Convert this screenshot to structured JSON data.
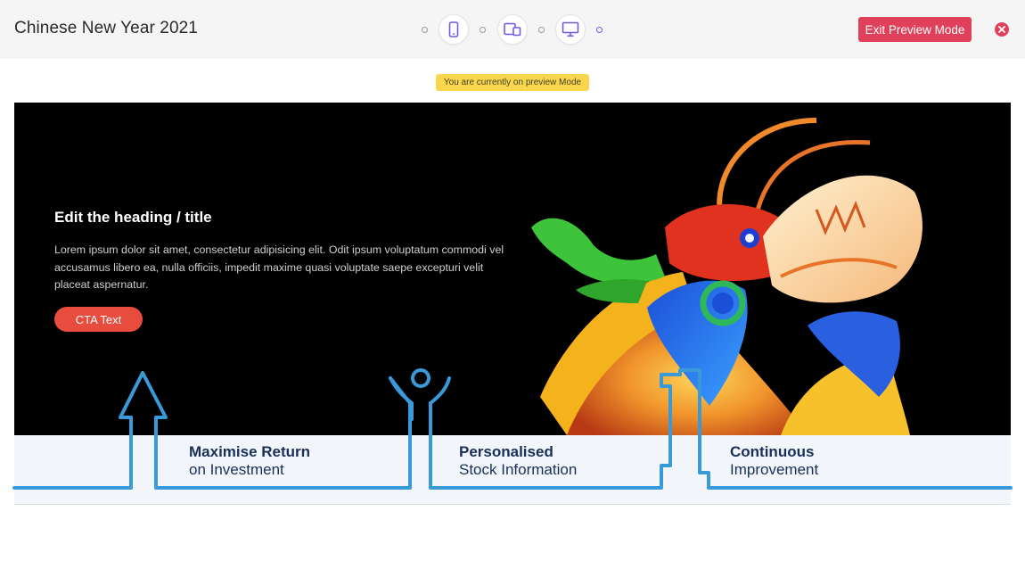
{
  "header": {
    "title": "Chinese New Year 2021",
    "exit_label": "Exit Preview Mode",
    "devices": [
      {
        "name": "mobile",
        "icon": "mobile-icon"
      },
      {
        "name": "tablet",
        "icon": "tablet-icon"
      },
      {
        "name": "desktop",
        "icon": "desktop-icon"
      }
    ],
    "accent_color": "#6b5ce7",
    "exit_color": "#e0405a"
  },
  "preview_notice": "You are currently on preview Mode",
  "hero": {
    "heading": "Edit the heading / title",
    "body": "Lorem ipsum dolor sit amet, consectetur adipisicing elit. Odit ipsum voluptatum commodi vel accusamus libero ea, nulla officiis, impedit maxime quasi voluptate saepe excepturi velit placeat aspernatur.",
    "cta": "CTA Text",
    "cta_color": "#e74c3c"
  },
  "features": [
    {
      "title": "Maximise Return",
      "subtitle": "on Investment"
    },
    {
      "title": "Personalised",
      "subtitle": "Stock Information"
    },
    {
      "title": "Continuous",
      "subtitle": "Improvement"
    }
  ],
  "line_color": "#3a9ad9"
}
